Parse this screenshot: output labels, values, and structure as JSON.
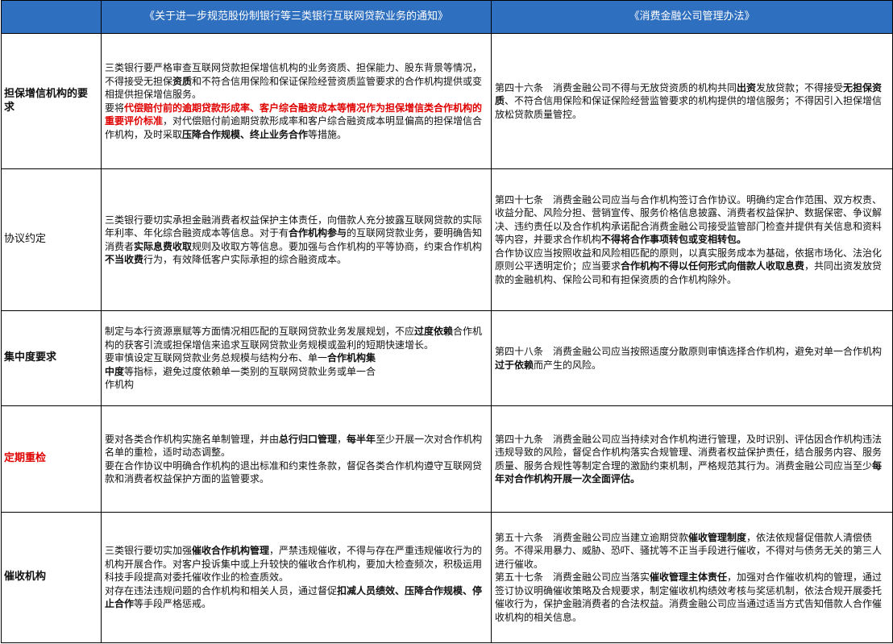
{
  "header": {
    "col1": "",
    "col2": "《关于进一步规范股份制银行等三类银行互联网贷款业务的通知》",
    "col3": "《消费金融公司管理办法》"
  },
  "colors": {
    "header_bg": "#2f6fbf",
    "highlight_red": "#e00000"
  },
  "rows": [
    {
      "label": "担保增信机构的要求",
      "bank": [
        [
          {
            "t": "三类银行要严格审查互联网贷款担保增信机构的业务资质、担保能力、股东背景等情况，不得接受无担保"
          },
          {
            "t": "资质",
            "s": "b"
          },
          {
            "t": "和不符合信用保险和保证保险经营资质监管要求的合作机构提供或变相提供担保增信服务。"
          }
        ],
        [
          {
            "t": "要将"
          },
          {
            "t": "代偿赔付前的逾期贷款形成率、客户综合融资成本等情况作为担保增信类合作机构的重要评价标准",
            "s": "r"
          },
          {
            "t": "，对代偿赔付前逾期贷款形成率和客户综合融资成本明显偏高的担保增信合作机构，及时采取"
          },
          {
            "t": "压降合作规模、终止业务合作",
            "s": "b"
          },
          {
            "t": "等措施。"
          }
        ]
      ],
      "consumer": [
        [
          {
            "t": "第四十六条　消费金融公司不得与无放贷资质的机构共同"
          },
          {
            "t": "出资",
            "s": "b"
          },
          {
            "t": "发放贷款；不得接受"
          },
          {
            "t": "无担保资质",
            "s": "b"
          },
          {
            "t": "、不符合信用保险和保证保险经营监管要求的机构提供的增信服务；不得因引入担保增信放松贷款质量管控。"
          }
        ]
      ]
    },
    {
      "label": "协议约定",
      "bank": [
        [
          {
            "t": "三类银行要切实承担金融消费者权益保护主体责任，向借款人充分披露互联网贷款的实际年利率、年化综合融资成本等信息。对于有"
          },
          {
            "t": "合作机构参与",
            "s": "b"
          },
          {
            "t": "的互联网贷款业务，要明确告知消费者"
          },
          {
            "t": "实际息费收取",
            "s": "b"
          },
          {
            "t": "规则及收取方等信息。要加强与合作机构的平等协商，约束合作机构"
          },
          {
            "t": "不当收费",
            "s": "b"
          },
          {
            "t": "行为，有效降低客户实际承担的综合融资成本。"
          }
        ]
      ],
      "consumer": [
        [
          {
            "t": "第四十七条　消费金融公司应当与合作机构签订合作协议。明确约定合作范围、双方权责、收益分配、风险分担、营销宣传、服务价格信息披露、消费者权益保护、数据保密、争议解决、违约责任以及合作机构承诺配合消费金融公司接受监管部门检查并提供有关信息和资料等内容，并要求合作机构"
          },
          {
            "t": "不得将合作事项转包或变相转包。",
            "s": "b"
          }
        ],
        [
          {
            "t": "合作协议应当按照收益和风险相匹配的原则，以真实服务成本为基础，依据市场化、法治化原则公平透明定价；应当要求"
          },
          {
            "t": "合作机构不得以任何形式向借款人收取息费",
            "s": "b"
          },
          {
            "t": "，共同出资发放贷款的金融机构、保险公司和有担保资质的合作机构除外。"
          }
        ]
      ]
    },
    {
      "label": "集中度要求",
      "bank": [
        [
          {
            "t": "制定与本行资源禀赋等方面情况相匹配的互联网贷款业务发展规划，不应"
          },
          {
            "t": "过度依赖",
            "s": "b"
          },
          {
            "t": "合作机构的获客引流或担保增信来追求互联网贷款业务规模或盈利的短期快速增长。"
          }
        ],
        [
          {
            "t": "要审慎设定互联网贷款业务总规模与结构分布、单一"
          },
          {
            "t": "合作机构集",
            "s": "b"
          }
        ],
        [
          {
            "t": "中度",
            "s": "b"
          },
          {
            "t": "等指标，避免过度依赖单一类别的互联网贷款业务或单一合"
          }
        ],
        [
          {
            "t": "作机构"
          }
        ]
      ],
      "consumer": [
        [
          {
            "t": "第四十八条　消费金融公司应当按照适度分散原则审慎选择合作机构，避免对单一合作机构"
          },
          {
            "t": "过于依赖",
            "s": "b"
          },
          {
            "t": "而产生的风险。"
          }
        ]
      ]
    },
    {
      "label": "定期重检",
      "bank": [
        [
          {
            "t": "要对各类合作机构实施名单制管理，并由"
          },
          {
            "t": "总行归口管理",
            "s": "b"
          },
          {
            "t": "，"
          },
          {
            "t": "每半年",
            "s": "b"
          },
          {
            "t": "至少开展一次对合作机构名单的重检，适时动态调整。"
          }
        ],
        [
          {
            "t": "要在合作协议中明确合作机构的退出标准和约束性条款，督促各类合作机构遵守互联网贷款和消费者权益保护方面的监管要求。"
          }
        ]
      ],
      "consumer": [
        [
          {
            "t": "第四十九条　消费金融公司应当持续对合作机构进行管理，及时识别、评估因合作机构违法违规导致的风险，督促合作机构落实合规管理、消费者权益保护责任，结合服务内容、服务质量、服务合规性等制定合理的激励约束机制，严格规范其行为。消费金融公司应当至少"
          },
          {
            "t": "每年对合作机构开展一次全面评估。",
            "s": "b"
          }
        ]
      ]
    },
    {
      "label": "催收机构",
      "bank": [
        [
          {
            "t": "三类银行要切实加强"
          },
          {
            "t": "催收合作机构管理",
            "s": "b"
          },
          {
            "t": "，严禁违规催收，不得与存在严重违规催收行为的机构开展合作。对客户投诉集中或上升较快的催收合作机构，要加大检查频次，积极运用科技手段提高对委托催收作业的检查质效。"
          }
        ],
        [
          {
            "t": "对存在违法违规问题的合作机构和相关人员，通过督促"
          },
          {
            "t": "扣减人员绩效、压降合作规模、停止合作",
            "s": "b"
          },
          {
            "t": "等手段严格惩戒。"
          }
        ]
      ],
      "consumer": [
        [
          {
            "t": "第五十六条　消费金融公司应当建立逾期贷款"
          },
          {
            "t": "催收管理制度",
            "s": "b"
          },
          {
            "t": "，依法依规督促借款人清偿债务。不得采用暴力、威胁、恐吓、骚扰等不正当手段进行催收，不得对与债务无关的第三人进行催收。"
          }
        ],
        [
          {
            "t": "第五十七条　消费金融公司应当落实"
          },
          {
            "t": "催收管理主体责任",
            "s": "b"
          },
          {
            "t": "，加强对合作催收机构的管理，通过签订协议明确催收策略及合规要求，制定催收机构绩效考核与奖惩机制，依法合规开展委托催收行为，保护金融消费者的合法权益。消费金融公司应当通过适当方式告知借款人合作催收机构的相关信息。"
          }
        ]
      ]
    }
  ]
}
